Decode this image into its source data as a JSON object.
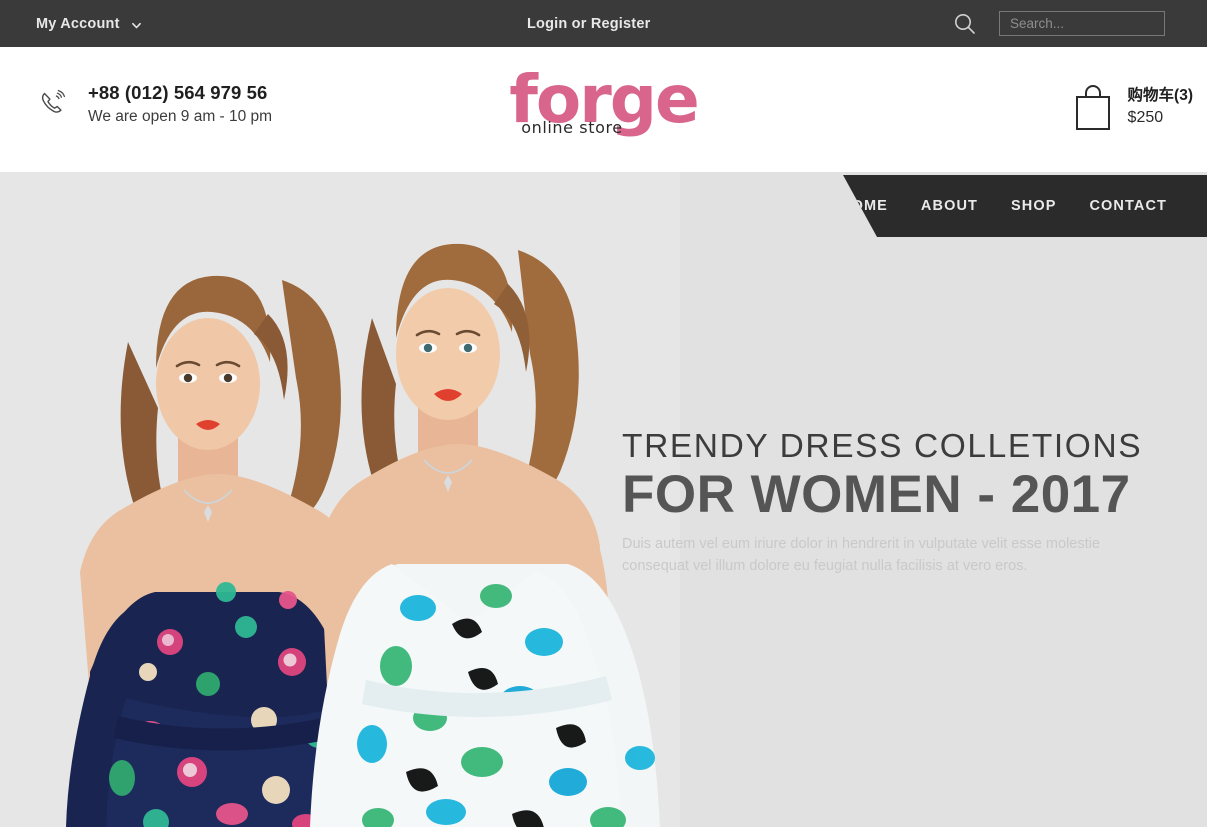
{
  "topbar": {
    "account_label": "My Account",
    "account_chevron_icon": "chevron-down-icon",
    "login_label": "Login or Register",
    "search_icon": "search-icon",
    "search_placeholder": "Search...",
    "search_value": "",
    "background_color": "#3a3a3a"
  },
  "header": {
    "phone_icon": "phone-ringing-icon",
    "phone_number": "+88 (012) 564 979 56",
    "open_hours": "We are open 9 am - 10 pm",
    "logo": {
      "name": "forge",
      "tagline": "online store",
      "color": "#d9658d"
    },
    "cart": {
      "icon": "shopping-bag-icon",
      "label": "购物车(3)",
      "total": "$250"
    }
  },
  "nav": {
    "background_color": "#2b2b2b",
    "items": [
      {
        "label": "HOME"
      },
      {
        "label": "ABOUT"
      },
      {
        "label": "SHOP"
      },
      {
        "label": "CONTACT"
      }
    ]
  },
  "hero": {
    "background_color": "#e1e1e1",
    "kicker": "TRENDY DRESS COLLETIONS",
    "title": "FOR WOMEN - 2017",
    "description": "Duis autem vel eum iriure dolor in hendrerit in vulputate velit esse molestie consequat vel illum dolore eu feugiat nulla facilisis at vero eros.",
    "photo_alt": "two-models-in-floral-dresses"
  }
}
